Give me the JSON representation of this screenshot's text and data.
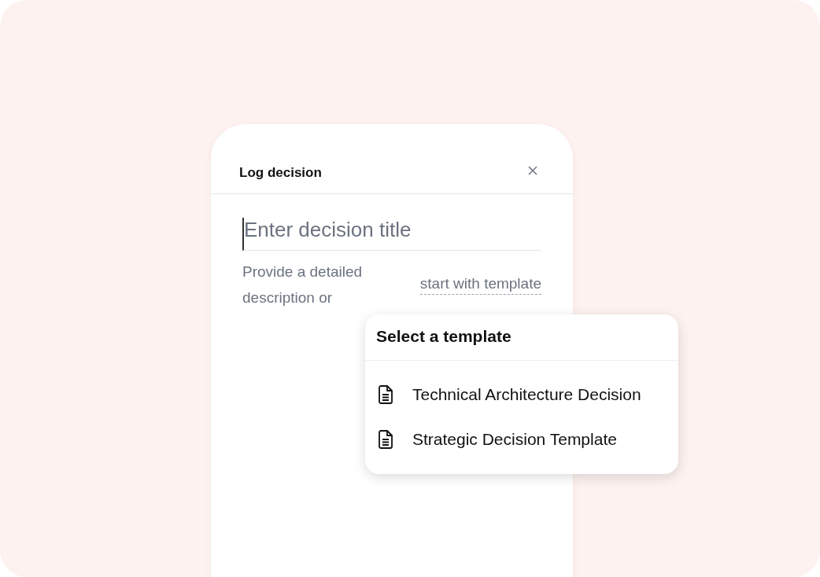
{
  "dialog": {
    "title": "Log decision",
    "title_field": {
      "placeholder": "Enter decision title"
    },
    "description_hint": "Provide a detailed description or",
    "template_link": "start with template"
  },
  "template_menu": {
    "title": "Select a template",
    "items": [
      {
        "label": "Technical Architecture Decision"
      },
      {
        "label": "Strategic Decision Template"
      }
    ]
  }
}
